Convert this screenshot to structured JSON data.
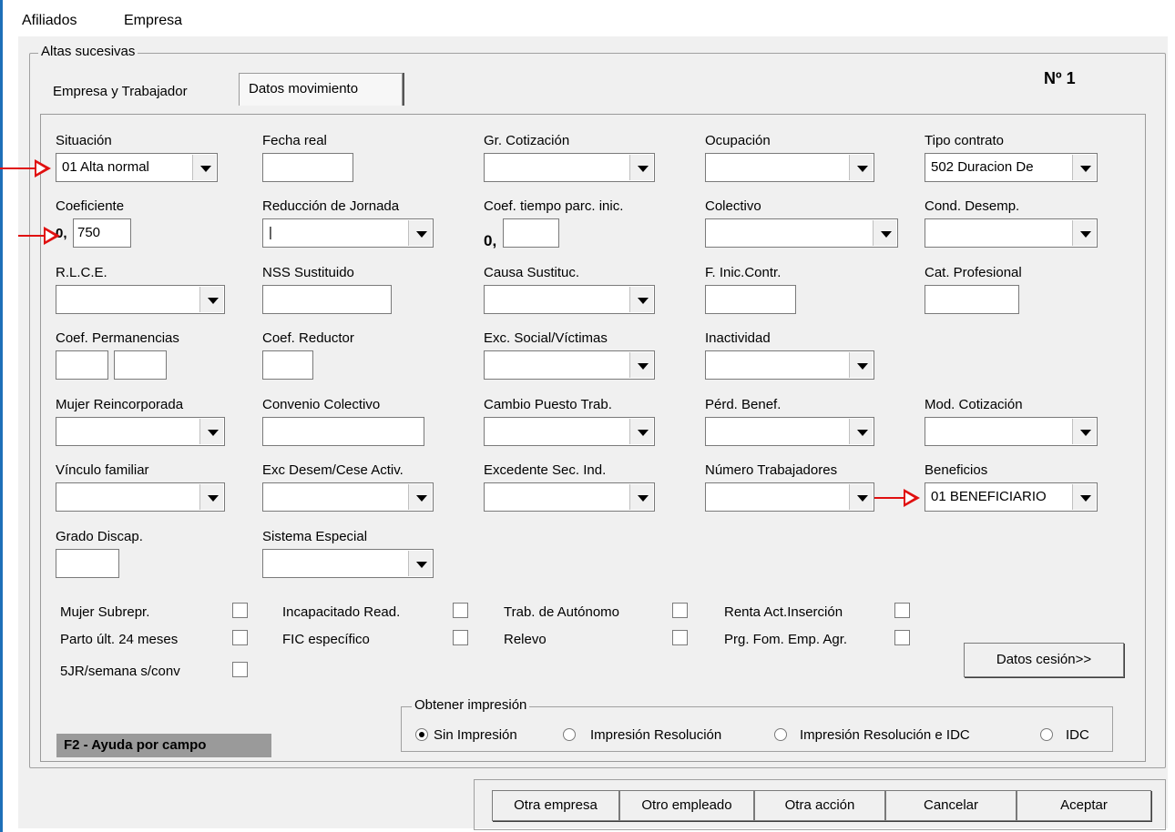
{
  "menu": [
    "Afiliados",
    "Empresa"
  ],
  "group_title": "Altas sucesivas",
  "numero": "Nº 1",
  "tabs": [
    {
      "label": "Empresa y Trabajador",
      "active": false
    },
    {
      "label": "Datos movimiento",
      "active": true
    }
  ],
  "fields": {
    "situacion": {
      "label": "Situación",
      "value": "01 Alta normal"
    },
    "fecha_real": {
      "label": "Fecha real",
      "value": ""
    },
    "gr_cotizacion": {
      "label": "Gr. Cotización",
      "value": ""
    },
    "ocupacion": {
      "label": "Ocupación",
      "value": ""
    },
    "tipo_contrato": {
      "label": "Tipo contrato",
      "value": "502 Duracion De"
    },
    "coeficiente": {
      "label": "Coeficiente",
      "prefix": "0,",
      "value": "750"
    },
    "reduccion_jornada": {
      "label": "Reducción de Jornada",
      "value": "|"
    },
    "coef_tiempo": {
      "label": "Coef. tiempo parc. inic.",
      "prefix": "0,",
      "value": ""
    },
    "colectivo": {
      "label": "Colectivo",
      "value": ""
    },
    "cond_desemp": {
      "label": "Cond. Desemp.",
      "value": ""
    },
    "rlce": {
      "label": "R.L.C.E.",
      "value": ""
    },
    "nss_sustituido": {
      "label": "NSS Sustituido",
      "value": ""
    },
    "causa_sustituc": {
      "label": "Causa Sustituc.",
      "value": ""
    },
    "f_inic_contr": {
      "label": "F. Inic.Contr.",
      "value": ""
    },
    "cat_profesional": {
      "label": "Cat. Profesional",
      "value": ""
    },
    "coef_permanencias": {
      "label": "Coef. Permanencias",
      "value1": "",
      "value2": ""
    },
    "coef_reductor": {
      "label": "Coef. Reductor",
      "value": ""
    },
    "exc_social": {
      "label": "Exc. Social/Víctimas",
      "value": ""
    },
    "inactividad": {
      "label": "Inactividad",
      "value": ""
    },
    "mujer_reincorporada": {
      "label": "Mujer Reincorporada",
      "value": ""
    },
    "convenio_colectivo": {
      "label": "Convenio Colectivo",
      "value": ""
    },
    "cambio_puesto": {
      "label": "Cambio Puesto Trab.",
      "value": ""
    },
    "perd_benef": {
      "label": "Pérd. Benef.",
      "value": ""
    },
    "mod_cotizacion": {
      "label": "Mod. Cotización",
      "value": ""
    },
    "vinculo_familiar": {
      "label": "Vínculo familiar",
      "value": ""
    },
    "exc_desem": {
      "label": "Exc Desem/Cese Activ.",
      "value": ""
    },
    "excedente_sec": {
      "label": "Excedente Sec. Ind.",
      "value": ""
    },
    "numero_trabajadores": {
      "label": "Número Trabajadores",
      "value": ""
    },
    "beneficios": {
      "label": "Beneficios",
      "value": "01 BENEFICIARIO"
    },
    "grado_discap": {
      "label": "Grado Discap.",
      "value": ""
    },
    "sistema_especial": {
      "label": "Sistema Especial",
      "value": ""
    }
  },
  "checkboxes": {
    "mujer_subrepr": "Mujer Subrepr.",
    "parto": "Parto últ. 24 meses",
    "cinco_jr": "5JR/semana s/conv",
    "incapacitado": "Incapacitado Read.",
    "fic": "FIC específico",
    "trab_autonomo": "Trab. de Autónomo",
    "relevo": "Relevo",
    "renta_act": "Renta Act.Inserción",
    "prg_fom": "Prg. Fom. Emp. Agr."
  },
  "datos_cesion_button": "Datos cesión>>",
  "impresion": {
    "legend": "Obtener impresión",
    "options": [
      "Sin Impresión",
      "Impresión Resolución",
      "Impresión Resolución e IDC",
      "IDC"
    ],
    "selected": "Sin Impresión"
  },
  "help_hint": "F2 - Ayuda por campo",
  "bottom_buttons": [
    "Otra empresa",
    "Otro empleado",
    "Otra acción",
    "Cancelar",
    "Aceptar"
  ]
}
